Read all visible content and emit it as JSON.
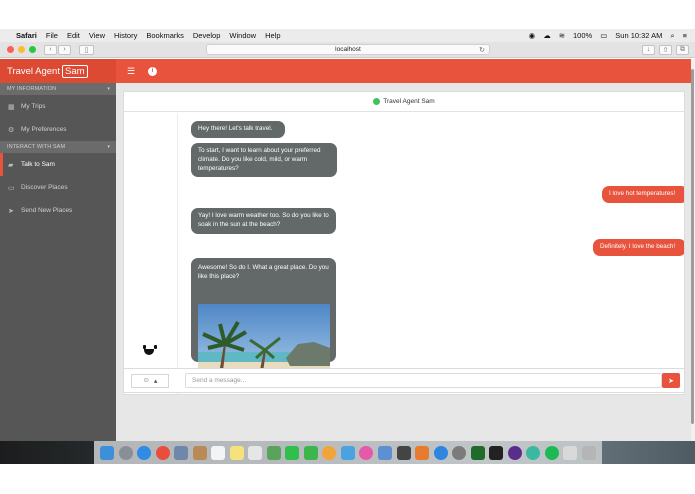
{
  "menubar": {
    "apple_icon": "apple-icon",
    "items": [
      "Safari",
      "File",
      "Edit",
      "View",
      "History",
      "Bookmarks",
      "Develop",
      "Window",
      "Help"
    ],
    "battery": "100%",
    "clock": "Sun 10:32 AM"
  },
  "browser": {
    "url": "localhost"
  },
  "app": {
    "brand": "Travel Agent",
    "brand_badge": "Sam",
    "accent_color": "#e8533d"
  },
  "sidebar": {
    "sections": [
      {
        "title": "MY INFORMATION",
        "items": [
          {
            "label": "My Trips",
            "icon": "grid-icon"
          },
          {
            "label": "My Preferences",
            "icon": "gear-icon"
          }
        ]
      },
      {
        "title": "INTERACT WITH SAM",
        "items": [
          {
            "label": "Talk to Sam",
            "icon": "chat-icon",
            "active": true
          },
          {
            "label": "Discover Places",
            "icon": "map-icon"
          },
          {
            "label": "Send New Places",
            "icon": "send-icon"
          }
        ]
      }
    ]
  },
  "chat": {
    "title": "Travel Agent Sam",
    "status_color": "#3fc35a",
    "messages": [
      {
        "from": "bot",
        "text": "Hey there! Let's talk travel."
      },
      {
        "from": "bot",
        "text": "To start, I want to learn about your preferred climate. Do you like cold, mild, or warm temperatures?"
      },
      {
        "from": "user",
        "text": "I love hot temperatures!"
      },
      {
        "from": "bot",
        "text": "Yay! I love warm weather too. So do you like to soak in the sun at the beach?"
      },
      {
        "from": "user",
        "text": "Definitely. I love the beach!"
      },
      {
        "from": "bot",
        "text": "Awesome! So do I. What a great place. Do you like this place?"
      }
    ],
    "composer": {
      "placeholder": "Send a message..."
    }
  }
}
